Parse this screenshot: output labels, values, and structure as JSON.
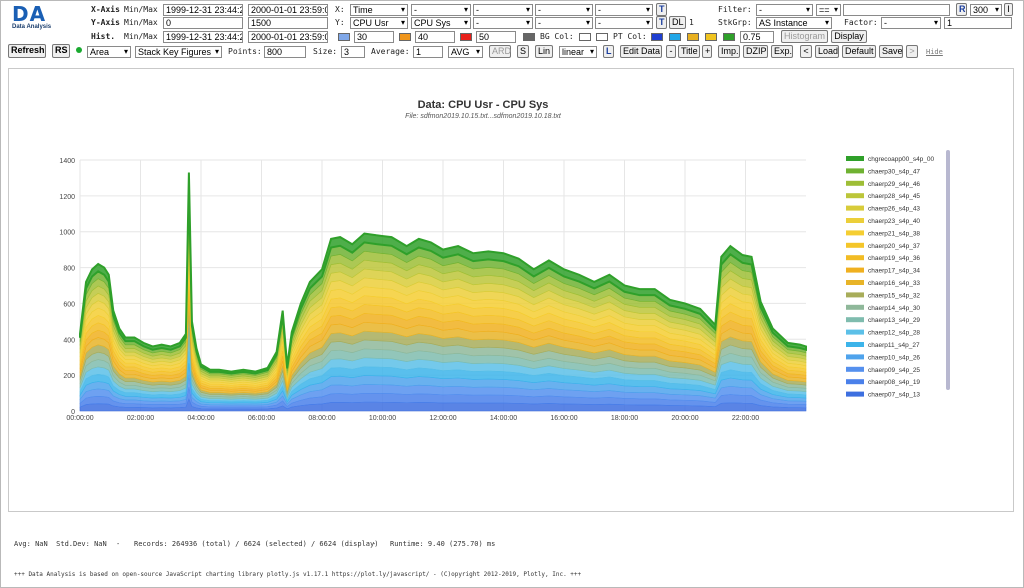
{
  "app": {
    "logo": "DA",
    "logo_sub": "Data Analysis"
  },
  "xaxis": {
    "label": "X-Axis",
    "sub": "Min/Max",
    "min": "1999-12-31 23:44:20",
    "max": "2000-01-01 23:59:00"
  },
  "yaxis": {
    "label": "Y-Axis",
    "sub": "Min/Max",
    "min": "0",
    "max": "1500"
  },
  "hist": {
    "label": "Hist.",
    "sub": "Min/Max",
    "min": "1999-12-31 23:44:20",
    "max": "2000-01-01 23:59:00"
  },
  "xsel": {
    "label": "X:",
    "value": "Time",
    "s2": "-",
    "s3": "-",
    "s4": "-",
    "s5": "-"
  },
  "ysel": {
    "label": "Y:",
    "v1": "CPU Usr",
    "v2": "CPU Sys",
    "v3": "-",
    "v4": "-",
    "v5": "-"
  },
  "thresholds": {
    "t1": "30",
    "t2": "40",
    "t3": "50"
  },
  "colors": {
    "c1": "#7fa7e8",
    "c2": "#f0961c",
    "c3": "#e8201a",
    "c4": "#666666",
    "pt1": "#1f3fd1",
    "pt2": "#22a7e8",
    "pt3": "#e8b020",
    "pt4": "#f0c420",
    "pt5": "#2fa02a",
    "accent": "#1a3d9c"
  },
  "bgcol": {
    "label": "BG Col:",
    "ptlabel": "PT Col:",
    "opacity": "0.75"
  },
  "buttons": {
    "t": "T",
    "dl_t": "T",
    "dl": "DL",
    "dl_val": "1",
    "histogram": "Histogram",
    "display": "Display",
    "r": "R",
    "refresh": "Refresh",
    "rs": "RS",
    "ard": "ARD",
    "s": "S",
    "lin": "Lin",
    "l": "L",
    "edit": "Edit Data",
    "dash": "-",
    "title": "Title",
    "plus": "+",
    "imp": "Imp.",
    "dzip": "DZIP",
    "exp": "Exp.",
    "lt": "<",
    "load": "Load",
    "default": "Default",
    "save": "Save",
    "gt": ">",
    "hide": "Hide",
    "info": "I"
  },
  "filter": {
    "label": "Filter:",
    "v1": "-",
    "op": "==",
    "value": ""
  },
  "stkgrp": {
    "label": "StkGrp:",
    "value": "AS Instance",
    "factor_label": "Factor:",
    "factor": "-",
    "factor_val": "1"
  },
  "rcount": "300",
  "row3": {
    "chart": "Area",
    "stack": "Stack Key Figures",
    "points_label": "Points:",
    "points": "800",
    "size_label": "Size:",
    "size": "3",
    "avg_label": "Average:",
    "avg": "1",
    "avgfn": "AVG",
    "scale": "linear"
  },
  "chart_data": {
    "type": "area",
    "title": "Data: CPU Usr - CPU Sys",
    "subtitle": "File: sdfmon2019.10.15.txt...sdfmon2019.10.18.txt",
    "xlabels": [
      "00:00:00",
      "02:00:00",
      "04:00:00",
      "06:00:00",
      "08:00:00",
      "10:00:00",
      "12:00:00",
      "14:00:00",
      "16:00:00",
      "18:00:00",
      "20:00:00",
      "22:00:00"
    ],
    "xrange_hours": [
      0,
      24
    ],
    "ylim": [
      0,
      1400
    ],
    "yticks": [
      0,
      200,
      400,
      600,
      800,
      1000,
      1200,
      1400
    ],
    "grid": true,
    "legend_position": "right",
    "total": [
      [
        0,
        430
      ],
      [
        0.2,
        720
      ],
      [
        0.4,
        790
      ],
      [
        0.6,
        820
      ],
      [
        0.8,
        800
      ],
      [
        0.95,
        760
      ],
      [
        1.1,
        560
      ],
      [
        1.3,
        460
      ],
      [
        1.5,
        410
      ],
      [
        1.8,
        410
      ],
      [
        2.1,
        380
      ],
      [
        2.4,
        360
      ],
      [
        2.7,
        370
      ],
      [
        3.0,
        360
      ],
      [
        3.3,
        380
      ],
      [
        3.5,
        430
      ],
      [
        3.6,
        1330
      ],
      [
        3.7,
        500
      ],
      [
        3.85,
        350
      ],
      [
        4.0,
        260
      ],
      [
        4.3,
        230
      ],
      [
        4.6,
        230
      ],
      [
        5.0,
        220
      ],
      [
        5.4,
        230
      ],
      [
        5.8,
        220
      ],
      [
        6.2,
        240
      ],
      [
        6.5,
        330
      ],
      [
        6.7,
        560
      ],
      [
        6.85,
        250
      ],
      [
        7.0,
        440
      ],
      [
        7.3,
        600
      ],
      [
        7.6,
        720
      ],
      [
        8.0,
        790
      ],
      [
        8.3,
        960
      ],
      [
        8.6,
        970
      ],
      [
        9.0,
        930
      ],
      [
        9.4,
        990
      ],
      [
        9.8,
        980
      ],
      [
        10.3,
        970
      ],
      [
        10.8,
        920
      ],
      [
        11.2,
        960
      ],
      [
        11.6,
        940
      ],
      [
        12.0,
        900
      ],
      [
        12.5,
        920
      ],
      [
        13.0,
        880
      ],
      [
        13.5,
        890
      ],
      [
        14.0,
        880
      ],
      [
        14.5,
        850
      ],
      [
        15.0,
        790
      ],
      [
        15.5,
        840
      ],
      [
        16.0,
        790
      ],
      [
        16.5,
        760
      ],
      [
        17.0,
        720
      ],
      [
        17.5,
        760
      ],
      [
        18.0,
        700
      ],
      [
        18.5,
        680
      ],
      [
        19.0,
        680
      ],
      [
        19.5,
        620
      ],
      [
        20.0,
        600
      ],
      [
        20.5,
        570
      ],
      [
        21.0,
        480
      ],
      [
        21.2,
        860
      ],
      [
        21.5,
        920
      ],
      [
        21.9,
        870
      ],
      [
        22.2,
        860
      ],
      [
        22.5,
        610
      ],
      [
        22.9,
        460
      ],
      [
        23.4,
        380
      ],
      [
        23.8,
        370
      ],
      [
        24.0,
        360
      ]
    ],
    "series": [
      {
        "name": "chaerp07_s4p_13",
        "color": "#3d6fe0",
        "share": 0.05
      },
      {
        "name": "chaerp08_s4p_19",
        "color": "#4a80ea",
        "share": 0.05
      },
      {
        "name": "chaerp09_s4p_25",
        "color": "#5590ee",
        "share": 0.05
      },
      {
        "name": "chaerp10_s4p_26",
        "color": "#4fa3ec",
        "share": 0.05
      },
      {
        "name": "chaerp11_s4p_27",
        "color": "#3cb4ea",
        "share": 0.05
      },
      {
        "name": "chaerp12_s4p_28",
        "color": "#5cc0e8",
        "share": 0.05
      },
      {
        "name": "chaerp13_s4p_29",
        "color": "#7fbcae",
        "share": 0.05
      },
      {
        "name": "chaerp14_s4p_30",
        "color": "#8fb89a",
        "share": 0.05
      },
      {
        "name": "chaerp15_s4p_32",
        "color": "#a8ad5a",
        "share": 0.05
      },
      {
        "name": "chaerp16_s4p_33",
        "color": "#e8b428",
        "share": 0.05
      },
      {
        "name": "chaerp17_s4p_34",
        "color": "#f0b020",
        "share": 0.05
      },
      {
        "name": "chaerp19_s4p_36",
        "color": "#f2bc24",
        "share": 0.05
      },
      {
        "name": "chaerp20_s4p_37",
        "color": "#f4c62a",
        "share": 0.05
      },
      {
        "name": "chaerp21_s4p_38",
        "color": "#f5ce32",
        "share": 0.05
      },
      {
        "name": "chaerp23_s4p_40",
        "color": "#eccf3a",
        "share": 0.05
      },
      {
        "name": "chaerp26_s4p_43",
        "color": "#d8cc3a",
        "share": 0.05
      },
      {
        "name": "chaerp28_s4p_45",
        "color": "#bcc63a",
        "share": 0.05
      },
      {
        "name": "chaerp29_s4p_46",
        "color": "#9ebe36",
        "share": 0.05
      },
      {
        "name": "chaerp30_s4p_47",
        "color": "#6fb232",
        "share": 0.05
      },
      {
        "name": "chgrecoapp00_s4p_00",
        "color": "#2fa02a",
        "share": 0.05
      }
    ]
  },
  "status": {
    "avg": "Avg: NaN  Std.Dev: NaN",
    "sep1": "-",
    "records": "Records: 264936 (total) / 6624 (selected) / 6624 (display)",
    "sep2": "-",
    "runtime": "Runtime: 9.40 (275.70) ms"
  },
  "footer": "+++ Data Analysis is based on open-source JavaScript charting library plotly.js v1.17.1 https://plot.ly/javascript/ - (C)opyright 2012-2019, Plotly, Inc. +++"
}
